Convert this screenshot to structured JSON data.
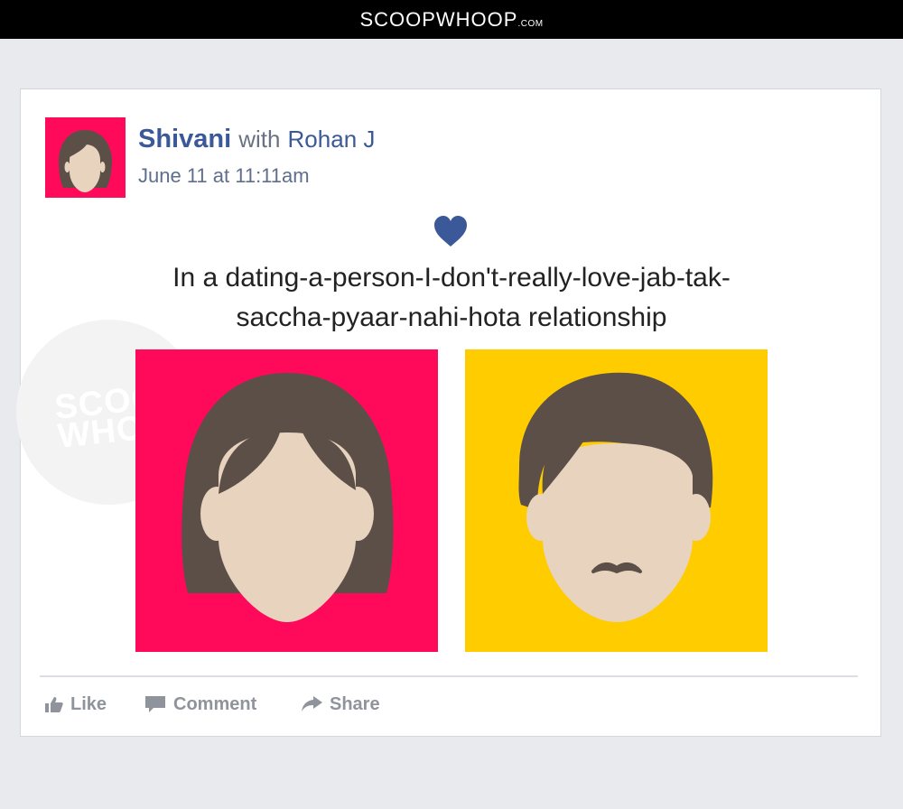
{
  "header": {
    "brand": "SCOOPWHOOP",
    "brand_tld": ".COM"
  },
  "watermark": {
    "line1": "SCOOP",
    "line2": "WHOOP"
  },
  "post": {
    "author": "Shivani",
    "with_label": "with",
    "tagged": "Rohan J",
    "timestamp": "June 11 at 11:11am",
    "status_icon": "heart-icon",
    "caption_line1": "In a dating-a-person-I-don't-really-love-jab-tak-",
    "caption_line2": "saccha-pyaar-nahi-hota relationship"
  },
  "actions": {
    "like": "Like",
    "comment": "Comment",
    "share": "Share"
  },
  "colors": {
    "accent": "#3b5998",
    "her_bg": "#ff0a5b",
    "him_bg": "#ffcc00",
    "hair": "#5b4f48",
    "skin": "#e8d3bf"
  }
}
